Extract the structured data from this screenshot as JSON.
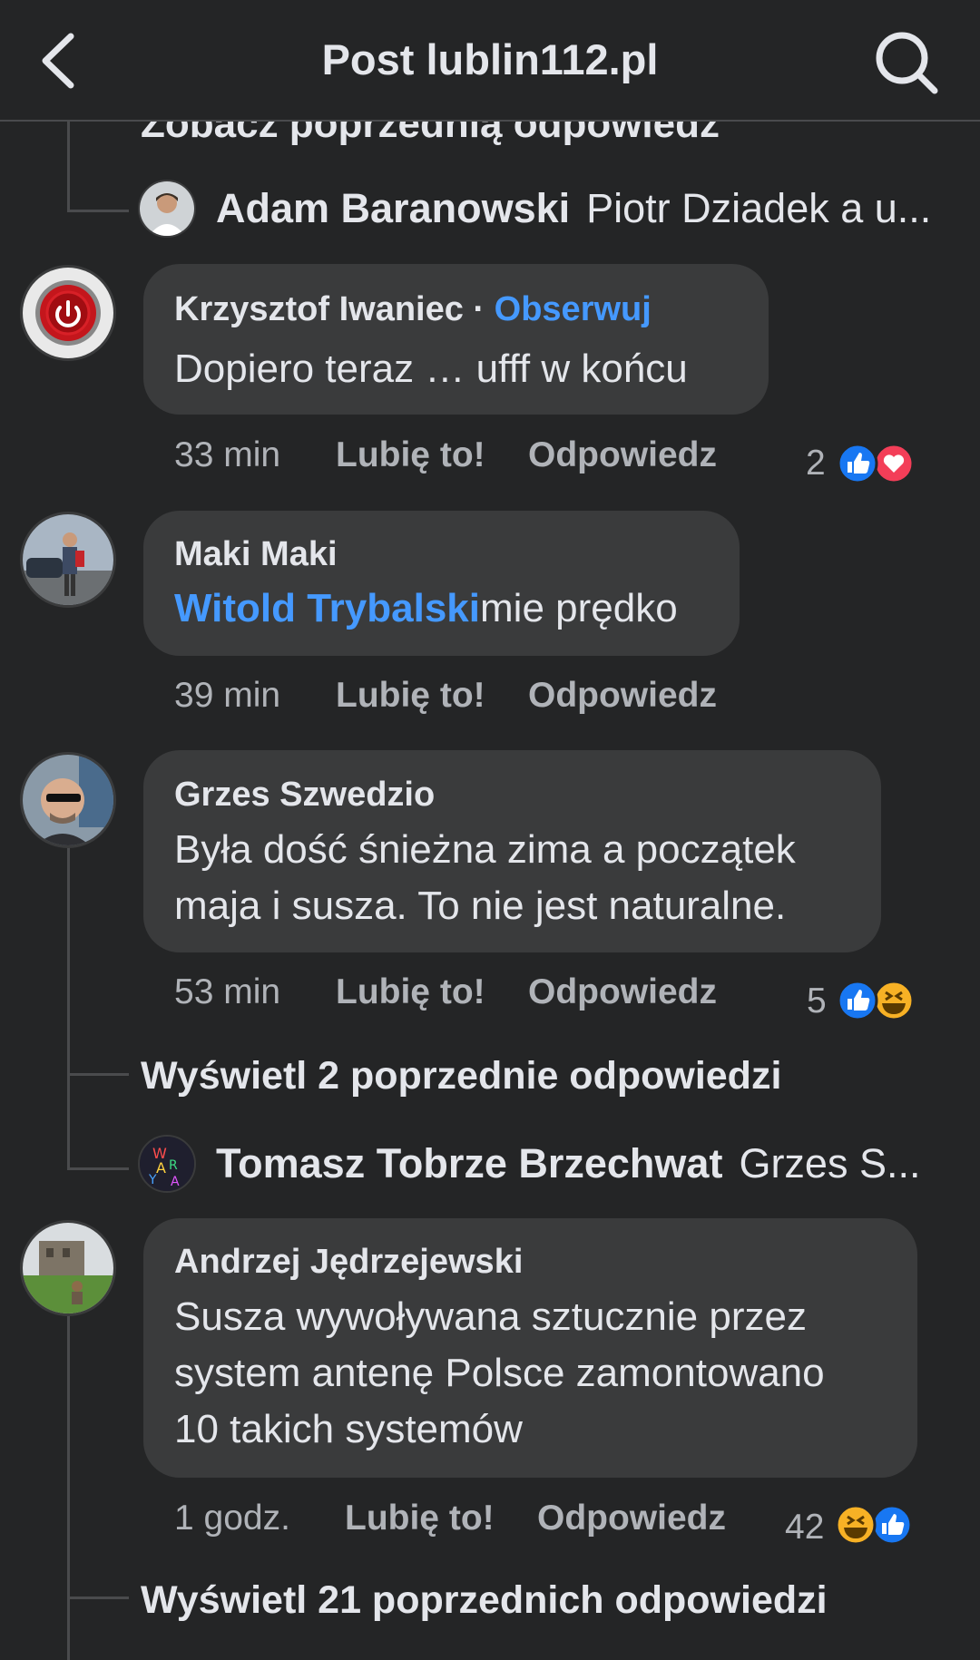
{
  "header": {
    "title": "Post lublin112.pl",
    "back_icon": "back-arrow-icon",
    "search_icon": "search-icon"
  },
  "partial_link": "Zobacz poprzednią odpowiedź",
  "reply1": {
    "name": "Adam Baranowski",
    "text": "Piotr Dziadek a u..."
  },
  "comments": [
    {
      "author": "Krzysztof Iwaniec",
      "separator": " · ",
      "follow": "Obserwuj",
      "text": "Dopiero teraz … ufff w końcu",
      "time": "33 min",
      "like": "Lubię to!",
      "reply": "Odpowiedz",
      "reaction_count": "2"
    },
    {
      "author": "Maki Maki",
      "mention": "Witold Trybalski",
      "text": "mie prędko",
      "time": "39 min",
      "like": "Lubię to!",
      "reply": "Odpowiedz"
    },
    {
      "author": "Grzes Szwedzio",
      "text_line1": "Była dość śnieżna zima a początek",
      "text_line2": "maja i susza. To nie jest naturalne.",
      "time": "53 min",
      "like": "Lubię to!",
      "reply": "Odpowiedz",
      "reaction_count": "5"
    },
    {
      "author": "Andrzej Jędrzejewski",
      "text_line1": "Susza wywoływana sztucznie przez",
      "text_line2": "system antenę Polsce zamontowano",
      "text_line3": "10 takich systemów",
      "time": "1 godz.",
      "like": "Lubię to!",
      "reply": "Odpowiedz",
      "reaction_count": "42"
    }
  ],
  "view_more_1": "Wyświetl 2 poprzednie odpowiedzi",
  "reply2": {
    "name": "Tomasz Tobrze Brzechwat",
    "text": "Grzes S..."
  },
  "view_more_2": "Wyświetl 21 poprzednich odpowiedzi",
  "colors": {
    "background": "#242526",
    "bubble": "#3a3b3c",
    "link": "#4599ff",
    "like_blue": "#1877f2",
    "love_red": "#f33e58",
    "haha_yellow": "#f7b125"
  }
}
